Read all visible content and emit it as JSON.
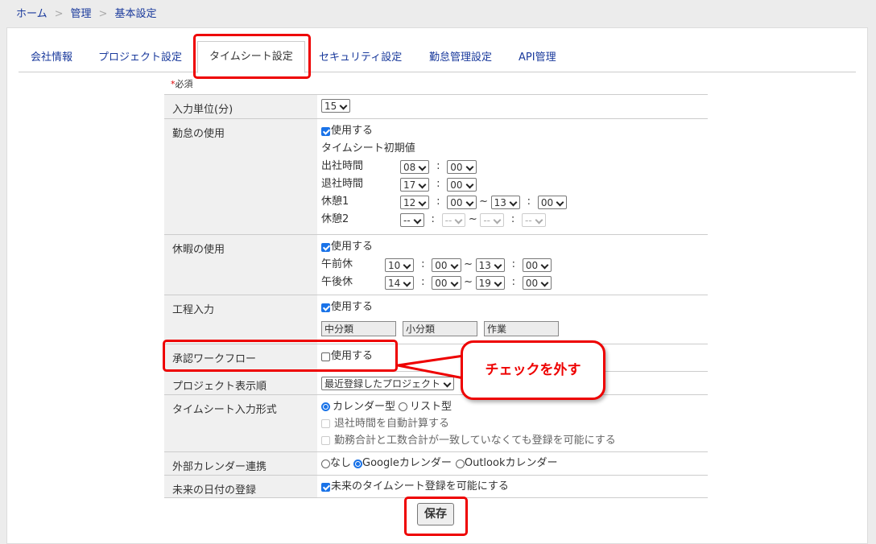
{
  "breadcrumb": [
    "ホーム",
    "管理",
    "基本設定"
  ],
  "breadcrumb_sep": ">",
  "tabs": [
    "会社情報",
    "プロジェクト設定",
    "タイムシート設定",
    "セキュリティ設定",
    "勤怠管理設定",
    "API管理"
  ],
  "active_tab": "タイムシート設定",
  "required_mark": "*",
  "required_text": "必須",
  "rows": {
    "input_unit": {
      "label": "入力単位(分)",
      "value": "15"
    },
    "attendance": {
      "label": "勤怠の使用",
      "checkbox": "使用する",
      "checked": true,
      "defaults_title": "タイムシート初期値",
      "start_label": "出社時間",
      "start_h": "08",
      "start_m": "00",
      "end_label": "退社時間",
      "end_h": "17",
      "end_m": "00",
      "break1_label": "休憩1",
      "break1": [
        "12",
        "00",
        "13",
        "00"
      ],
      "break2_label": "休憩2",
      "break2": [
        "--",
        "--",
        "--",
        "--"
      ]
    },
    "leave": {
      "label": "休暇の使用",
      "checkbox": "使用する",
      "checked": true,
      "am_label": "午前休",
      "am": [
        "10",
        "00",
        "13",
        "00"
      ],
      "pm_label": "午後休",
      "pm": [
        "14",
        "00",
        "19",
        "00"
      ]
    },
    "process": {
      "label": "工程入力",
      "checkbox": "使用する",
      "checked": true,
      "fields": [
        "中分類",
        "小分類",
        "作業"
      ]
    },
    "workflow": {
      "label": "承認ワークフロー",
      "checkbox": "使用する",
      "checked": false
    },
    "project_order": {
      "label": "プロジェクト表示順",
      "value": "最近登録したプロジェクト"
    },
    "input_format": {
      "label": "タイムシート入力形式",
      "options": [
        "カレンダー型",
        "リスト型"
      ],
      "selected": "カレンダー型",
      "auto_calc": "退社時間を自動計算する",
      "allow_mismatch": "勤務合計と工数合計が一致していなくても登録を可能にする"
    },
    "calendar": {
      "label": "外部カレンダー連携",
      "options": [
        "なし",
        "Googleカレンダー",
        "Outlookカレンダー"
      ],
      "selected": "Googleカレンダー"
    },
    "future": {
      "label": "未来の日付の登録",
      "checkbox": "未来のタイムシート登録を可能にする",
      "checked": true
    }
  },
  "colon": ":",
  "tilde": "~",
  "callout": "チェックを外す",
  "save_label": "保存",
  "colors": {
    "accent": "#1a73e8",
    "link": "#1a3a9c",
    "highlight": "#ee0000"
  }
}
